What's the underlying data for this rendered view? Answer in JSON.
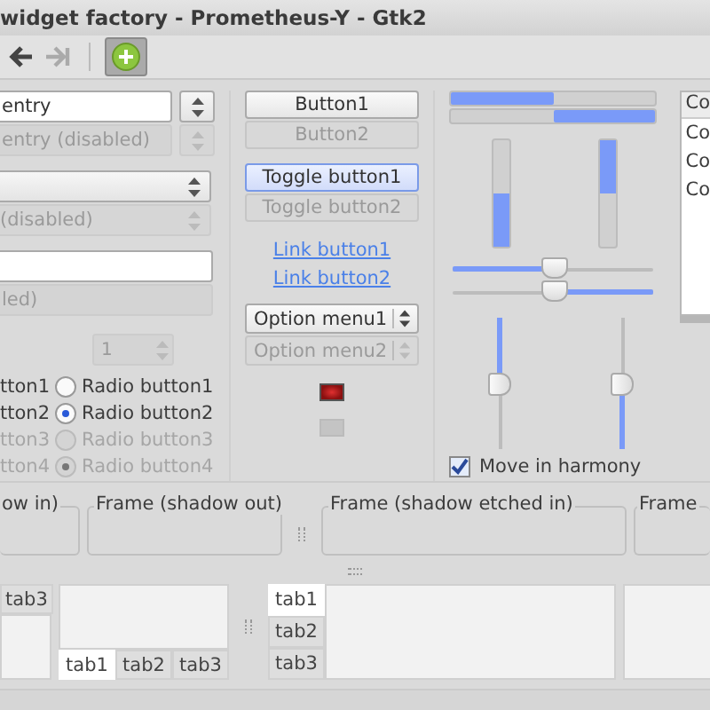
{
  "window": {
    "title": "widget factory - Prometheus-Y - Gtk2"
  },
  "toolbar": [
    {
      "kind": "back",
      "disabled": false,
      "active": false
    },
    {
      "kind": "forward",
      "disabled": true,
      "active": false
    },
    {
      "kind": "add",
      "disabled": false,
      "active": true
    }
  ],
  "combo_entries": [
    {
      "value": "entry",
      "disabled": false
    },
    {
      "value": "entry (disabled)",
      "disabled": true
    }
  ],
  "combos": [
    {
      "disabled": false
    },
    {
      "value": "(disabled)",
      "disabled": true
    }
  ],
  "entries": [
    {
      "disabled": false
    },
    {
      "value": "led)",
      "disabled": true
    }
  ],
  "spin": {
    "value": "1",
    "disabled": true
  },
  "check_buttons": [
    {
      "label": "tton1",
      "disabled": false
    },
    {
      "label": "tton2",
      "disabled": false
    },
    {
      "label": "tton3",
      "disabled": true
    },
    {
      "label": "tton4",
      "disabled": true
    }
  ],
  "radio_buttons": [
    {
      "label": "Radio button1",
      "selected": false,
      "disabled": false
    },
    {
      "label": "Radio button2",
      "selected": true,
      "disabled": false
    },
    {
      "label": "Radio button3",
      "selected": false,
      "disabled": true
    },
    {
      "label": "Radio button4",
      "selected": true,
      "disabled": true
    }
  ],
  "buttons": [
    {
      "label": "Button1",
      "disabled": false
    },
    {
      "label": "Button2",
      "disabled": true
    }
  ],
  "toggle_buttons": [
    {
      "label": "Toggle button1",
      "active": true,
      "disabled": false
    },
    {
      "label": "Toggle button2",
      "active": false,
      "disabled": true
    }
  ],
  "link_buttons": [
    "Link button1",
    "Link button2"
  ],
  "option_menus": [
    {
      "label": "Option menu1",
      "disabled": false
    },
    {
      "label": "Option menu2",
      "disabled": true
    }
  ],
  "indicators": [
    {
      "on": true
    },
    {
      "on": false
    }
  ],
  "progress_bars": [
    {
      "level": 0.5,
      "inverted": false
    },
    {
      "level": 0.5,
      "inverted": true
    }
  ],
  "vertical_progress_bars": [
    {
      "level": 0.5,
      "inverted": false
    },
    {
      "level": 0.5,
      "inverted": true
    }
  ],
  "scales": [
    {
      "level": 0.5,
      "inverted": false
    },
    {
      "level": 0.5,
      "inverted": true
    }
  ],
  "vertical_scales": [
    {
      "level": 0.5,
      "inverted": true
    },
    {
      "level": 0.5,
      "inverted": false
    }
  ],
  "move_in_harmony": {
    "label": "Move in harmony",
    "checked": true
  },
  "tree": {
    "header": "Co",
    "rows": [
      "Co",
      "Co",
      "Co"
    ]
  },
  "frames": [
    {
      "label": "ow in)"
    },
    {
      "label": "Frame (shadow out)"
    },
    {
      "label": "Frame (shadow etched in)"
    },
    {
      "label": "Frame"
    }
  ],
  "notebooks": [
    {
      "kind": "top",
      "tabs": [
        {
          "label": "tab3",
          "selected": false
        }
      ]
    },
    {
      "kind": "bottom",
      "tabs": [
        {
          "label": "tab1",
          "selected": true
        },
        {
          "label": "tab2",
          "selected": false
        },
        {
          "label": "tab3",
          "selected": false
        }
      ]
    },
    {
      "kind": "left",
      "tabs": [
        {
          "label": "tab1",
          "selected": true
        },
        {
          "label": "tab2",
          "selected": false
        },
        {
          "label": "tab3",
          "selected": false
        }
      ]
    }
  ]
}
